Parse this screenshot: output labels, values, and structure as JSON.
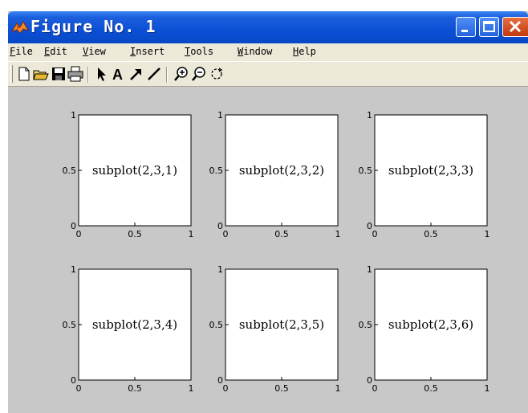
{
  "window": {
    "title": "Figure No. 1",
    "menu": [
      {
        "label": "File",
        "mnemonic": "F",
        "rest": "ile"
      },
      {
        "label": "Edit",
        "mnemonic": "E",
        "rest": "dit"
      },
      {
        "label": "View",
        "mnemonic": "V",
        "rest": "iew"
      },
      {
        "label": "Insert",
        "mnemonic": "I",
        "rest": "nsert"
      },
      {
        "label": "Tools",
        "mnemonic": "T",
        "rest": "ools"
      },
      {
        "label": "Window",
        "mnemonic": "W",
        "rest": "indow"
      },
      {
        "label": "Help",
        "mnemonic": "H",
        "rest": "elp"
      }
    ],
    "toolbar": [
      {
        "icon": "new-file-icon"
      },
      {
        "icon": "open-folder-icon"
      },
      {
        "icon": "save-icon"
      },
      {
        "icon": "print-icon"
      },
      {
        "icon": "select-arrow-icon"
      },
      {
        "icon": "insert-text-icon",
        "glyph": "A"
      },
      {
        "icon": "insert-arrow-icon"
      },
      {
        "icon": "insert-line-icon"
      },
      {
        "icon": "zoom-in-icon"
      },
      {
        "icon": "zoom-out-icon"
      },
      {
        "icon": "rotate-3d-icon"
      }
    ]
  },
  "chart_data": [
    {
      "type": "subplot",
      "label": "subplot(2,3,1)",
      "xlim": [
        0,
        1
      ],
      "ylim": [
        0,
        1
      ],
      "xticks": [
        "0",
        "0.5",
        "1"
      ],
      "yticks": [
        "0",
        "0.5",
        "1"
      ]
    },
    {
      "type": "subplot",
      "label": "subplot(2,3,2)",
      "xlim": [
        0,
        1
      ],
      "ylim": [
        0,
        1
      ],
      "xticks": [
        "0",
        "0.5",
        "1"
      ],
      "yticks": [
        "0",
        "0.5",
        "1"
      ]
    },
    {
      "type": "subplot",
      "label": "subplot(2,3,3)",
      "xlim": [
        0,
        1
      ],
      "ylim": [
        0,
        1
      ],
      "xticks": [
        "0",
        "0.5",
        "1"
      ],
      "yticks": [
        "0",
        "0.5",
        "1"
      ]
    },
    {
      "type": "subplot",
      "label": "subplot(2,3,4)",
      "xlim": [
        0,
        1
      ],
      "ylim": [
        0,
        1
      ],
      "xticks": [
        "0",
        "0.5",
        "1"
      ],
      "yticks": [
        "0",
        "0.5",
        "1"
      ]
    },
    {
      "type": "subplot",
      "label": "subplot(2,3,5)",
      "xlim": [
        0,
        1
      ],
      "ylim": [
        0,
        1
      ],
      "xticks": [
        "0",
        "0.5",
        "1"
      ],
      "yticks": [
        "0",
        "0.5",
        "1"
      ]
    },
    {
      "type": "subplot",
      "label": "subplot(2,3,6)",
      "xlim": [
        0,
        1
      ],
      "ylim": [
        0,
        1
      ],
      "xticks": [
        "0",
        "0.5",
        "1"
      ],
      "yticks": [
        "0",
        "0.5",
        "1"
      ]
    }
  ]
}
